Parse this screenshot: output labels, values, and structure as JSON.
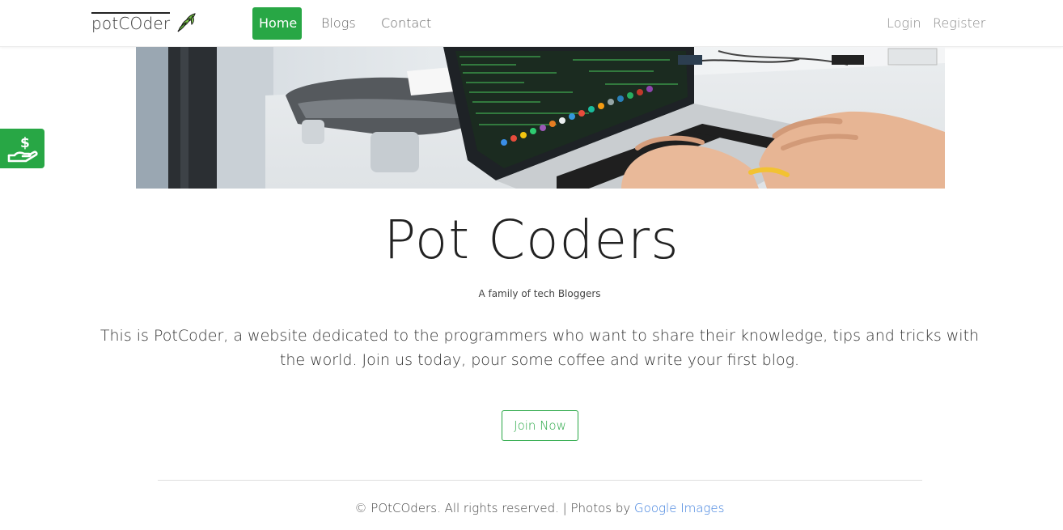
{
  "brand": {
    "name": "potCOder",
    "logo_icon": "leaf-icon"
  },
  "nav": {
    "items": [
      {
        "label": "Home",
        "active": true
      },
      {
        "label": "Blogs",
        "active": false
      },
      {
        "label": "Contact",
        "active": false
      }
    ],
    "right": [
      {
        "label": "Login"
      },
      {
        "label": "Register"
      }
    ]
  },
  "donate": {
    "icon": "donate-hand-dollar-icon"
  },
  "hero": {
    "image_alt": "laptop-typing-photo"
  },
  "main": {
    "title": "Pot Coders",
    "subtitle": "A family of tech Bloggers",
    "lead": "This is PotCoder, a website dedicated to the programmers who want to share their knowledge, tips and tricks with the world. Join us today, pour some coffee and write your first blog.",
    "cta_label": "Join Now"
  },
  "footer": {
    "text": "© POtCOders. All rights reserved. | Photos by ",
    "link_label": "Google Images"
  },
  "colors": {
    "accent": "#28a745",
    "link": "#3b7ddd"
  }
}
